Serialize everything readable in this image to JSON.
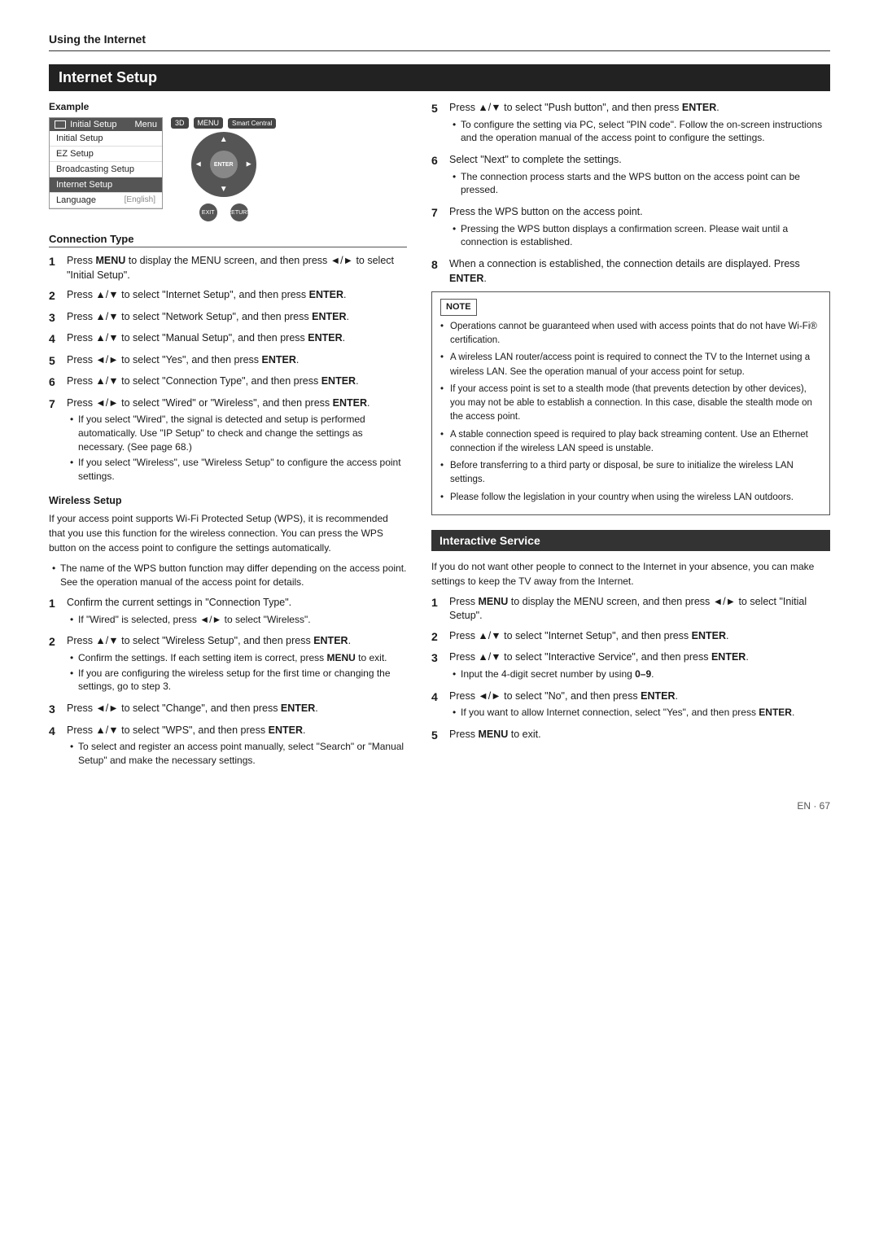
{
  "header": {
    "section": "Using the Internet"
  },
  "main_section": {
    "title": "Internet Setup",
    "example_label": "Example",
    "menu": {
      "header_icon": "tv",
      "header_left": "Initial Setup",
      "header_right": "Menu",
      "items": [
        {
          "label": "Initial Setup",
          "state": "normal"
        },
        {
          "label": "EZ Setup",
          "state": "normal"
        },
        {
          "label": "Broadcasting Setup",
          "state": "normal"
        },
        {
          "label": "Internet Setup",
          "state": "active"
        },
        {
          "label": "Language",
          "state": "normal"
        },
        {
          "label": "[English]",
          "state": "sub"
        }
      ]
    },
    "remote": {
      "btn_3d": "3D",
      "btn_menu": "MENU",
      "btn_smart_central": "Smart Central",
      "btn_enter": "ENTER",
      "btn_exit": "EXIT",
      "btn_return": "RETURN"
    },
    "connection_type": {
      "title": "Connection Type",
      "steps": [
        {
          "num": "1",
          "text": "Press MENU to display the MENU screen, and then press ◄/► to select \"Initial Setup\".",
          "bold_words": [
            "MENU"
          ]
        },
        {
          "num": "2",
          "text": "Press ▲/▼ to select \"Internet Setup\", and then press ENTER.",
          "bold_words": [
            "ENTER"
          ]
        },
        {
          "num": "3",
          "text": "Press ▲/▼ to select \"Network Setup\", and then press ENTER.",
          "bold_words": [
            "ENTER"
          ]
        },
        {
          "num": "4",
          "text": "Press ▲/▼ to select \"Manual Setup\", and then press ENTER.",
          "bold_words": [
            "ENTER"
          ]
        },
        {
          "num": "5",
          "text": "Press ◄/► to select \"Yes\", and then press ENTER.",
          "bold_words": [
            "ENTER"
          ]
        },
        {
          "num": "6",
          "text": "Press ▲/▼ to select \"Connection Type\", and then press ENTER.",
          "bold_words": [
            "ENTER"
          ]
        },
        {
          "num": "7",
          "text": "Press ◄/► to select \"Wired\" or \"Wireless\", and then press ENTER.",
          "bold_words": [
            "ENTER"
          ],
          "bullets": [
            "If you select \"Wired\", the signal is detected and setup is performed automatically. Use \"IP Setup\" to check and change the settings as necessary. (See page 68.)",
            "If you select \"Wireless\", use \"Wireless Setup\" to configure the access point settings."
          ]
        }
      ]
    },
    "wireless_setup": {
      "title": "Wireless Setup",
      "intro": "If your access point supports Wi-Fi Protected Setup (WPS), it is recommended that you use this function for the wireless connection. You can press the WPS button on the access point to configure the settings automatically.",
      "bullets_intro": [
        "The name of the WPS button function may differ depending on the access point. See the operation manual of the access point for details."
      ],
      "steps": [
        {
          "num": "1",
          "text": "Confirm the current settings in \"Connection Type\".",
          "bullets": [
            "If \"Wired\" is selected, press ◄/► to select \"Wireless\"."
          ]
        },
        {
          "num": "2",
          "text": "Press ▲/▼ to select \"Wireless Setup\", and then press ENTER.",
          "bold_words": [
            "ENTER"
          ],
          "bullets": [
            "Confirm the settings. If each setting item is correct, press MENU to exit.",
            "If you are configuring the wireless setup for the first time or changing the settings, go to step 3."
          ]
        },
        {
          "num": "3",
          "text": "Press ◄/► to select \"Change\", and then press ENTER.",
          "bold_words": [
            "ENTER"
          ]
        },
        {
          "num": "4",
          "text": "Press ▲/▼ to select \"WPS\", and then press ENTER.",
          "bold_words": [
            "ENTER"
          ],
          "bullets": [
            "To select and register an access point manually, select \"Search\" or \"Manual Setup\" and make the necessary settings."
          ]
        }
      ]
    }
  },
  "right_column": {
    "steps_continued": [
      {
        "num": "5",
        "text": "Press ▲/▼ to select \"Push button\", and then press ENTER.",
        "bold_words": [
          "ENTER"
        ],
        "bullets": [
          "To configure the setting via PC, select \"PIN code\". Follow the on-screen instructions and the operation manual of the access point to configure the settings."
        ]
      },
      {
        "num": "6",
        "text": "Select \"Next\" to complete the settings.",
        "bullets": [
          "The connection process starts and the WPS button on the access point can be pressed."
        ]
      },
      {
        "num": "7",
        "text": "Press the WPS button on the access point.",
        "bullets": [
          "Pressing the WPS button displays a confirmation screen. Please wait until a connection is established."
        ]
      },
      {
        "num": "8",
        "text": "When a connection is established, the connection details are displayed. Press ENTER.",
        "bold_words": [
          "ENTER"
        ]
      }
    ],
    "note": {
      "title": "NOTE",
      "items": [
        "Operations cannot be guaranteed when used with access points that do not have Wi-Fi® certification.",
        "A wireless LAN router/access point is required to connect the TV to the Internet using a wireless LAN. See the operation manual of your access point for setup.",
        "If your access point is set to a stealth mode (that prevents detection by other devices), you may not be able to establish a connection. In this case, disable the stealth mode on the access point.",
        "A stable connection speed is required to play back streaming content. Use an Ethernet connection if the wireless LAN speed is unstable.",
        "Before transferring to a third party or disposal, be sure to initialize the wireless LAN settings.",
        "Please follow the legislation in your country when using the wireless LAN outdoors."
      ]
    },
    "interactive_service": {
      "title": "Interactive Service",
      "intro": "If you do not want other people to connect to the Internet in your absence, you can make settings to keep the TV away from the Internet.",
      "steps": [
        {
          "num": "1",
          "text": "Press MENU to display the MENU screen, and then press ◄/► to select \"Initial Setup\".",
          "bold_words": [
            "MENU"
          ]
        },
        {
          "num": "2",
          "text": "Press ▲/▼ to select \"Internet Setup\", and then press ENTER.",
          "bold_words": [
            "ENTER"
          ]
        },
        {
          "num": "3",
          "text": "Press ▲/▼ to select \"Interactive Service\", and then press ENTER.",
          "bold_words": [
            "ENTER"
          ],
          "bullets": [
            "Input the 4-digit secret number by using 0–9."
          ]
        },
        {
          "num": "4",
          "text": "Press ◄/► to select \"No\", and then press ENTER.",
          "bold_words": [
            "ENTER"
          ],
          "bullets": [
            "If you want to allow Internet connection, select \"Yes\", and then press ENTER."
          ]
        },
        {
          "num": "5",
          "text": "Press MENU to exit.",
          "bold_words": [
            "MENU"
          ]
        }
      ]
    }
  },
  "page_number": "EN · 67"
}
